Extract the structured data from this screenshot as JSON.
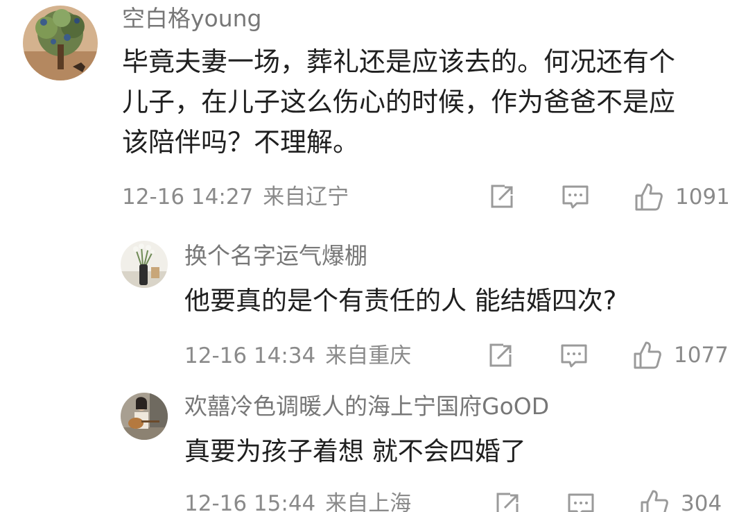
{
  "comments": [
    {
      "username": "空白格young",
      "text_lines": [
        "毕竟夫妻一场，葬礼还是应该去的。何况还有个",
        "儿子，在儿子这么伤心的时候，作为爸爸不是应",
        "该陪伴吗？不理解。"
      ],
      "time": "12-16 14:27",
      "location": "来自辽宁",
      "likes": "1091",
      "avatar_icon": "tree-painting-avatar"
    },
    {
      "username": "换个名字运气爆棚",
      "text_lines": [
        "他要真的是个有责任的人  能结婚四次?"
      ],
      "time": "12-16 14:34",
      "location": "来自重庆",
      "likes": "1077",
      "avatar_icon": "flower-vase-avatar"
    },
    {
      "username": "欢囍冷色调暖人的海上宁国府GoOD",
      "text_lines": [
        "真要为孩子着想 就不会四婚了"
      ],
      "time": "12-16 15:44",
      "location": "来自上海",
      "likes": "304",
      "avatar_icon": "person-guitar-avatar"
    }
  ],
  "icons": {
    "share": "share-icon",
    "reply": "comment-icon",
    "like": "thumbs-up-icon"
  },
  "colors": {
    "text": "#1f1f1f",
    "username": "#777777",
    "meta": "#8a8a8a",
    "icon": "#9a9a9a"
  }
}
